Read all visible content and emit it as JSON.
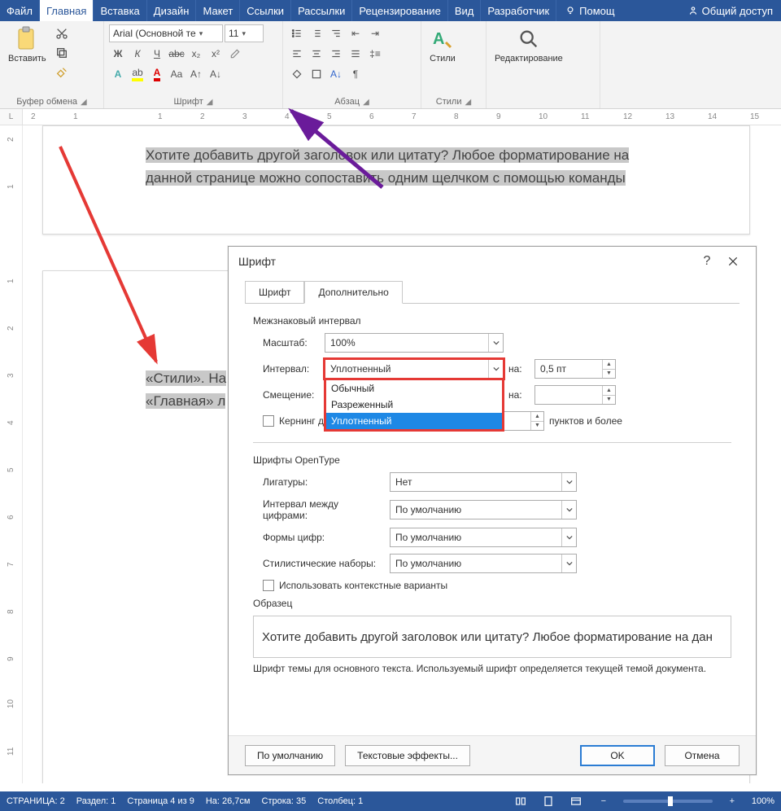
{
  "tabs": {
    "file": "Файл",
    "home": "Главная",
    "insert": "Вставка",
    "design": "Дизайн",
    "layout": "Макет",
    "refs": "Ссылки",
    "mail": "Рассылки",
    "review": "Рецензирование",
    "view": "Вид",
    "dev": "Разработчик",
    "help": "Помощ",
    "share": "Общий доступ"
  },
  "ribbon": {
    "paste": "Вставить",
    "clipboard": "Буфер обмена",
    "font_name": "Arial (Основной те",
    "font_size": "11",
    "font_group": "Шрифт",
    "para_group": "Абзац",
    "styles": "Стили",
    "styles_group": "Стили",
    "editing": "Редактирование"
  },
  "doc": {
    "line1": "Хотите добавить другой заголовок или цитату? Любое форматирование на",
    "line2": "данной странице можно сопоставить одним щелчком с помощью команды",
    "line3": "«Стили». На",
    "line4": "«Главная» л"
  },
  "ruler_nums": [
    "2",
    "1",
    "",
    "1",
    "2",
    "3",
    "4",
    "5",
    "6",
    "7",
    "8",
    "9",
    "10",
    "11",
    "12",
    "13",
    "14",
    "15"
  ],
  "vruler_nums": [
    "2",
    "1",
    "",
    "1",
    "2",
    "3",
    "4",
    "5",
    "6",
    "7",
    "8",
    "9",
    "10",
    "11"
  ],
  "dialog": {
    "title": "Шрифт",
    "tab_font": "Шрифт",
    "tab_adv": "Дополнительно",
    "section_spacing": "Межзнаковый интервал",
    "scale_label": "Масштаб:",
    "scale_value": "100%",
    "spacing_label": "Интервал:",
    "spacing_value": "Уплотненный",
    "spacing_options": {
      "normal": "Обычный",
      "expanded": "Разреженный",
      "condensed": "Уплотненный"
    },
    "by_label": "на:",
    "by_value": "0,5 пт",
    "position_label": "Смещение:",
    "position_by_label": "на:",
    "kerning_label": "Кернинг для знаков размером:",
    "kerning_suffix": "пунктов и более",
    "section_opentype": "Шрифты OpenType",
    "ligatures_label": "Лигатуры:",
    "ligatures_value": "Нет",
    "numspacing_label": "Интервал между цифрами:",
    "default_value": "По умолчанию",
    "numforms_label": "Формы цифр:",
    "stylistic_label": "Стилистические наборы:",
    "contextual_label": "Использовать контекстные варианты",
    "preview_label": "Образец",
    "preview_text": "Хотите добавить другой заголовок или цитату? Любое форматирование на дан",
    "preview_note": "Шрифт темы для основного текста. Используемый шрифт определяется текущей темой документа.",
    "btn_default": "По умолчанию",
    "btn_effects": "Текстовые эффекты...",
    "btn_ok": "OK",
    "btn_cancel": "Отмена"
  },
  "status": {
    "page": "СТРАНИЦА: 2",
    "section": "Раздел: 1",
    "pages": "Страница 4 из 9",
    "at": "На: 26,7см",
    "line": "Строка: 35",
    "col": "Столбец: 1",
    "zoom": "100%"
  }
}
